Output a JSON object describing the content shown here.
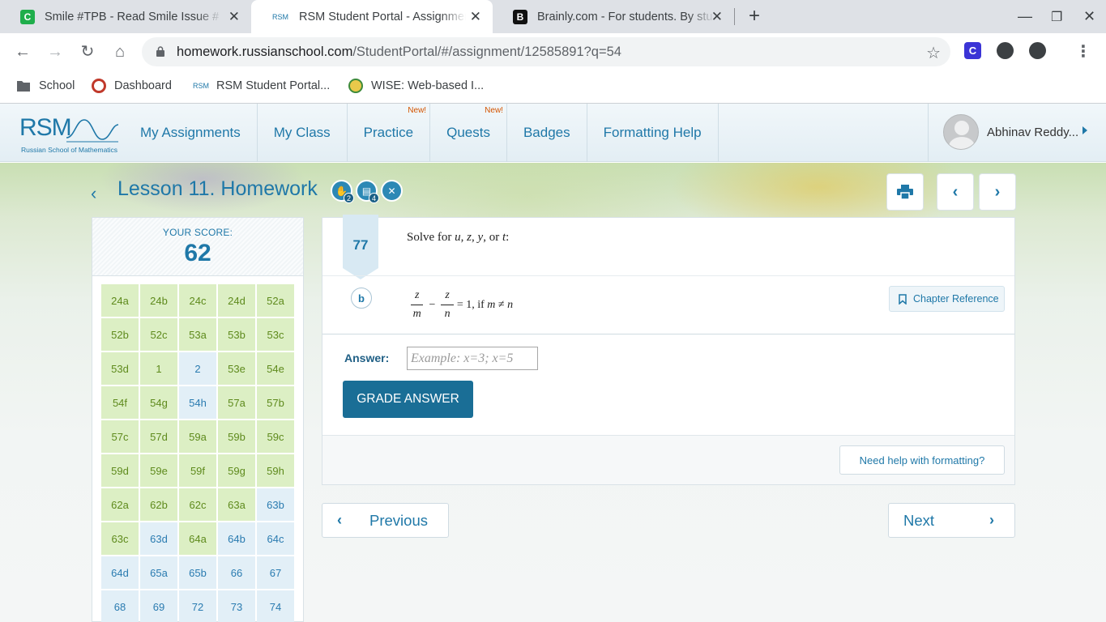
{
  "browser": {
    "tabs": [
      {
        "title": "Smile #TPB - Read Smile Issue #",
        "favicon": "C",
        "active": false
      },
      {
        "title": "RSM Student Portal - Assignmen",
        "favicon": "RSM",
        "active": true
      },
      {
        "title": "Brainly.com - For students. By stu",
        "favicon": "B",
        "active": false
      }
    ],
    "url_host": "homework.russianschool.com",
    "url_path": "/StudentPortal/#/assignment/12585891?q=54",
    "bookmarks": [
      {
        "label": "School",
        "icon": "folder-icon"
      },
      {
        "label": "Dashboard",
        "icon": "dashboard-icon"
      },
      {
        "label": "RSM Student Portal...",
        "icon": "rsm-icon"
      },
      {
        "label": "WISE: Web-based I...",
        "icon": "wise-icon"
      }
    ]
  },
  "header": {
    "logo_text": "RSM",
    "logo_sub": "Russian School of Mathematics",
    "nav": [
      {
        "label": "My Assignments",
        "new": ""
      },
      {
        "label": "My Class",
        "new": ""
      },
      {
        "label": "Practice",
        "new": "New!"
      },
      {
        "label": "Quests",
        "new": "New!"
      },
      {
        "label": "Badges",
        "new": ""
      },
      {
        "label": "Formatting Help",
        "new": ""
      }
    ],
    "user_name": "Abhinav Reddy..."
  },
  "lesson": {
    "title": "Lesson 11. Homework",
    "icon_counts": [
      "2",
      "4",
      ""
    ]
  },
  "score": {
    "label": "YOUR SCORE:",
    "value": "62"
  },
  "questions": [
    {
      "id": "24a",
      "done": true
    },
    {
      "id": "24b",
      "done": true
    },
    {
      "id": "24c",
      "done": true
    },
    {
      "id": "24d",
      "done": true
    },
    {
      "id": "52a",
      "done": true
    },
    {
      "id": "52b",
      "done": true
    },
    {
      "id": "52c",
      "done": true
    },
    {
      "id": "53a",
      "done": true
    },
    {
      "id": "53b",
      "done": true
    },
    {
      "id": "53c",
      "done": true
    },
    {
      "id": "53d",
      "done": true
    },
    {
      "id": "1",
      "done": true
    },
    {
      "id": "2",
      "done": false
    },
    {
      "id": "53e",
      "done": true
    },
    {
      "id": "54e",
      "done": true
    },
    {
      "id": "54f",
      "done": true
    },
    {
      "id": "54g",
      "done": true
    },
    {
      "id": "54h",
      "done": false
    },
    {
      "id": "57a",
      "done": true
    },
    {
      "id": "57b",
      "done": true
    },
    {
      "id": "57c",
      "done": true
    },
    {
      "id": "57d",
      "done": true
    },
    {
      "id": "59a",
      "done": true
    },
    {
      "id": "59b",
      "done": true
    },
    {
      "id": "59c",
      "done": true
    },
    {
      "id": "59d",
      "done": true
    },
    {
      "id": "59e",
      "done": true
    },
    {
      "id": "59f",
      "done": true
    },
    {
      "id": "59g",
      "done": true
    },
    {
      "id": "59h",
      "done": true
    },
    {
      "id": "62a",
      "done": true
    },
    {
      "id": "62b",
      "done": true
    },
    {
      "id": "62c",
      "done": true
    },
    {
      "id": "63a",
      "done": true
    },
    {
      "id": "63b",
      "done": false
    },
    {
      "id": "63c",
      "done": true
    },
    {
      "id": "63d",
      "done": false
    },
    {
      "id": "64a",
      "done": true
    },
    {
      "id": "64b",
      "done": false
    },
    {
      "id": "64c",
      "done": false
    },
    {
      "id": "64d",
      "done": false
    },
    {
      "id": "65a",
      "done": false
    },
    {
      "id": "65b",
      "done": false
    },
    {
      "id": "66",
      "done": false
    },
    {
      "id": "67",
      "done": false
    },
    {
      "id": "68",
      "done": false
    },
    {
      "id": "69",
      "done": false
    },
    {
      "id": "72",
      "done": false
    },
    {
      "id": "73",
      "done": false
    },
    {
      "id": "74",
      "done": false
    }
  ],
  "question": {
    "number": "77",
    "prompt_lead": "Solve for",
    "prompt_vars": [
      "u",
      "z",
      "y",
      "t"
    ],
    "part": "b",
    "equation": {
      "frac1_num": "z",
      "frac1_den": "m",
      "op": "−",
      "frac2_num": "z",
      "frac2_den": "n",
      "rhs": "= 1, if",
      "cond_lhs": "m",
      "cond_op": "≠",
      "cond_rhs": "n"
    },
    "chapter_reference": "Chapter Reference",
    "answer_label": "Answer:",
    "answer_value": "",
    "answer_placeholder": "Example: x=3; x=5",
    "grade_button": "GRADE ANSWER",
    "help_formatting": "Need help with formatting?"
  },
  "pager": {
    "previous": "Previous",
    "next": "Next"
  }
}
